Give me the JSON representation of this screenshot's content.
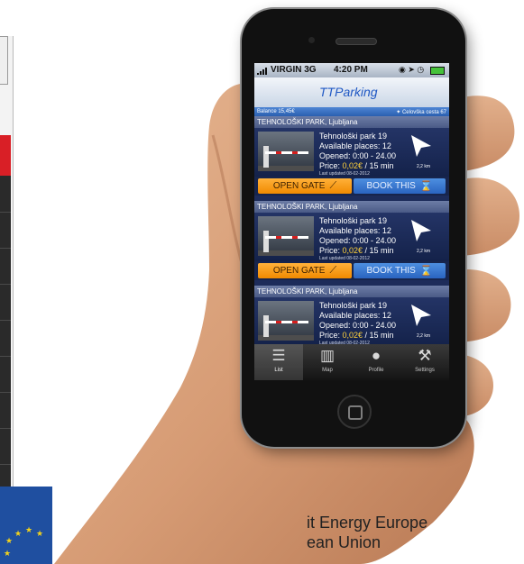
{
  "status_bar": {
    "carrier": "VIRGIN 3G",
    "time": "4:20 PM"
  },
  "app": {
    "logo": "TTParking",
    "balance": "Balance 15,45€",
    "location": "Celovška cesta 67"
  },
  "cards": [
    {
      "header": "TEHNOLOŠKI PARK, Ljubljana",
      "name": "Tehnološki park 19",
      "available": "Available places: 12",
      "opened": "Opened: 0:00 - 24.00",
      "price_label": "Price: ",
      "price_value": "0,02€",
      "price_unit": " / 15 min",
      "updated": "Last updated 08-02-2012",
      "distance": "2,2 km",
      "open_gate": "OPEN GATE",
      "book_this": "BOOK THIS"
    },
    {
      "header": "TEHNOLOŠKI PARK, Ljubljana",
      "name": "Tehnološki park 19",
      "available": "Available places: 12",
      "opened": "Opened: 0:00 - 24.00",
      "price_label": "Price: ",
      "price_value": "0,02€",
      "price_unit": " / 15 min",
      "updated": "Last updated 08-02-2012",
      "distance": "2,2 km",
      "open_gate": "OPEN GATE",
      "book_this": "BOOK THIS"
    },
    {
      "header": "TEHNOLOŠKI PARK, Ljubljana",
      "name": "Tehnološki park 19",
      "available": "Available places: 12",
      "opened": "Opened: 0:00 - 24.00",
      "price_label": "Price: ",
      "price_value": "0,02€",
      "price_unit": " / 15 min",
      "updated": "Last updated 08-02-2012",
      "distance": "2,2 km"
    }
  ],
  "tabs": [
    {
      "label": "List",
      "icon": "list-icon"
    },
    {
      "label": "Map",
      "icon": "map-icon"
    },
    {
      "label": "Profile",
      "icon": "profile-icon"
    },
    {
      "label": "Settings",
      "icon": "wrench-icon"
    }
  ],
  "background": {
    "footer_line1": "it Energy Europe",
    "footer_line2": "ean Union"
  },
  "colors": {
    "open_gate": "#f08a00",
    "book_this": "#2a64c0",
    "price": "#ffd13a",
    "app_bar": "#c9d6e6",
    "eu_blue": "#1f4fa0"
  }
}
